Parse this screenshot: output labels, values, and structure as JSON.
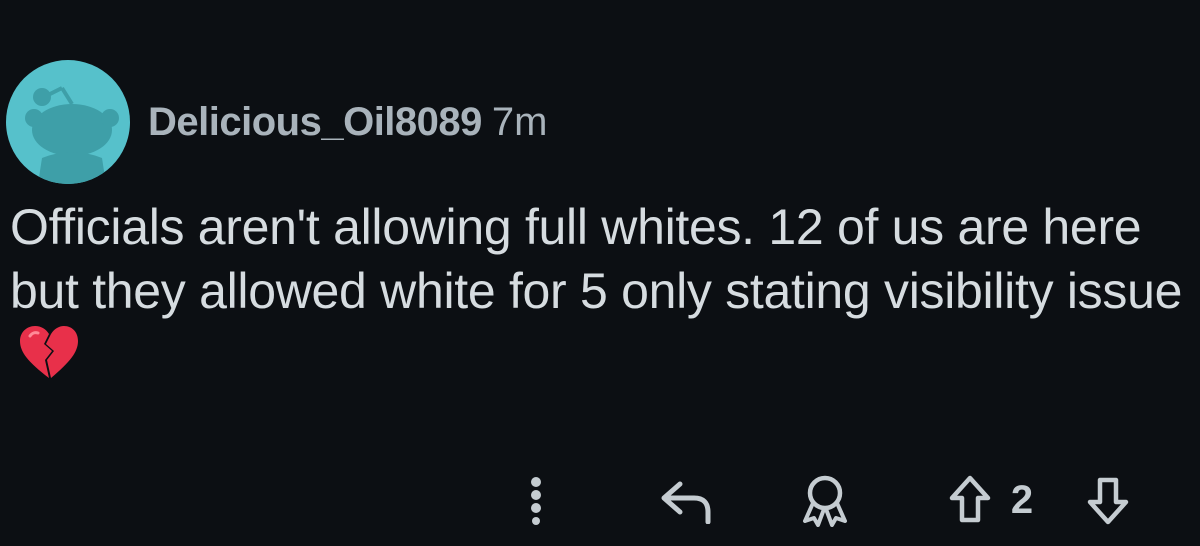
{
  "comment": {
    "author": "Delicious_Oil8089",
    "age": "7m",
    "text": "Officials aren't allowing full whites. 12 of us are here but they allowed white for 5 only stating visibility issue",
    "emoji": "broken-heart-icon"
  },
  "actions": {
    "score": "2",
    "icons": [
      "more-options-icon",
      "reply-icon",
      "award-icon",
      "upvote-icon",
      "downvote-icon"
    ]
  },
  "colors": {
    "background": "#0c0f13",
    "avatar": "#56c1cb",
    "text": "#d6dce0",
    "muted": "#a9b3bb",
    "heart": "#e8304a"
  }
}
